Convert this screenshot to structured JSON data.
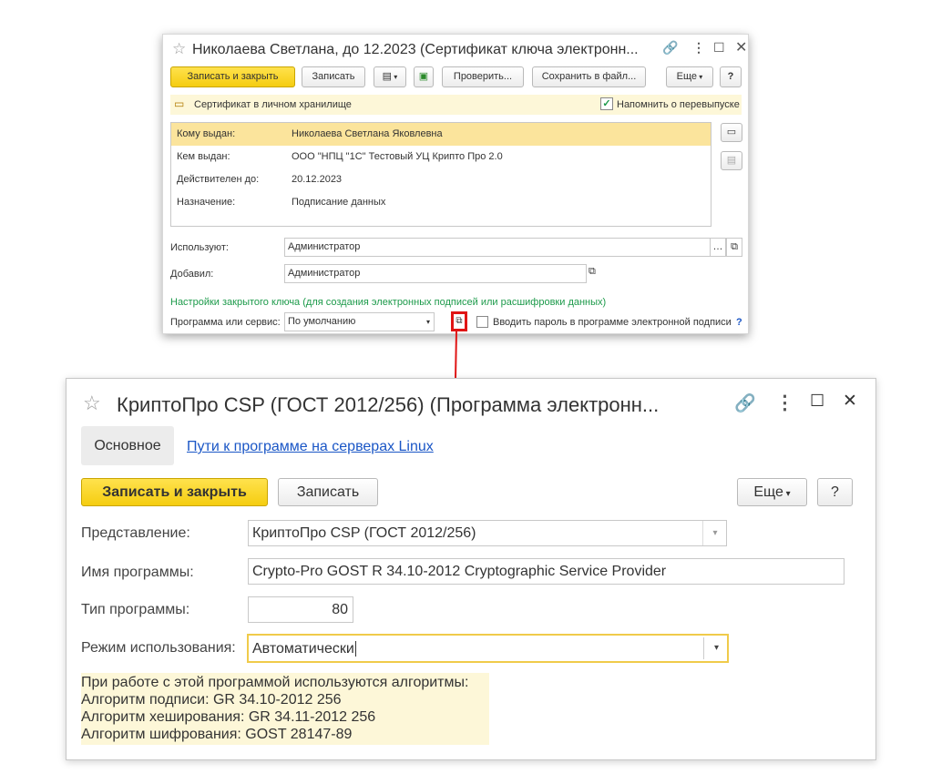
{
  "cert_window": {
    "title": "Николаева Светлана, до 12.2023 (Сертификат ключа электронн...",
    "toolbar": {
      "save_close": "Записать и закрыть",
      "save": "Записать",
      "check": "Проверить...",
      "save_to_file": "Сохранить в файл...",
      "more": "Еще",
      "help": "?"
    },
    "banner": {
      "text": "Сертификат в личном хранилище",
      "remind_label": "Напомнить о перевыпуске",
      "remind_checked": true
    },
    "cert_fields": [
      {
        "label": "Кому выдан:",
        "value": "Николаева Светлана Яковлевна"
      },
      {
        "label": "Кем выдан:",
        "value": "ООО \"НПЦ \"1С\" Тестовый УЦ Крипто Про 2.0"
      },
      {
        "label": "Действителен до:",
        "value": "20.12.2023"
      },
      {
        "label": "Назначение:",
        "value": "Подписание данных"
      }
    ],
    "used_by": {
      "label": "Используют:",
      "value": "Администратор"
    },
    "added_by": {
      "label": "Добавил:",
      "value": "Администратор"
    },
    "private_key_settings": "Настройки закрытого ключа (для создания электронных подписей или расшифровки данных)",
    "program": {
      "label": "Программа или сервис:",
      "value": "По умолчанию"
    },
    "enter_password_label": "Вводить пароль в программе электронной подписи",
    "enter_password_checked": false,
    "help_link": "?"
  },
  "program_window": {
    "title": "КриптоПро CSP (ГОСТ 2012/256) (Программа электронн...",
    "tabs": [
      {
        "label": "Основное",
        "active": true
      },
      {
        "label": "Пути к программе на серверах Linux",
        "active": false
      }
    ],
    "toolbar": {
      "save_close": "Записать и закрыть",
      "save": "Записать",
      "more": "Еще",
      "help": "?"
    },
    "fields": {
      "representation": {
        "label": "Представление:",
        "value": "КриптоПро CSP (ГОСТ 2012/256)"
      },
      "program_name": {
        "label": "Имя программы:",
        "value": "Crypto-Pro GOST R 34.10-2012 Cryptographic Service Provider"
      },
      "program_type": {
        "label": "Тип программы:",
        "value": "80"
      },
      "usage_mode": {
        "label": "Режим использования:",
        "value": "Автоматически"
      }
    },
    "info_lines": [
      "При работе с этой программой используются алгоритмы:",
      "Алгоритм подписи: GR 34.10-2012 256",
      "Алгоритм хеширования: GR 34.11-2012 256",
      "Алгоритм шифрования: GOST 28147-89"
    ]
  },
  "colors": {
    "accent_yellow": "#f5cd10",
    "highlight_row": "#fbe49c",
    "banner_bg": "#fdf7d8",
    "info_bg": "#fdf7d8",
    "green_text": "#1c9a4a",
    "link_blue": "#1a56c6",
    "callout_red": "#e01515"
  }
}
